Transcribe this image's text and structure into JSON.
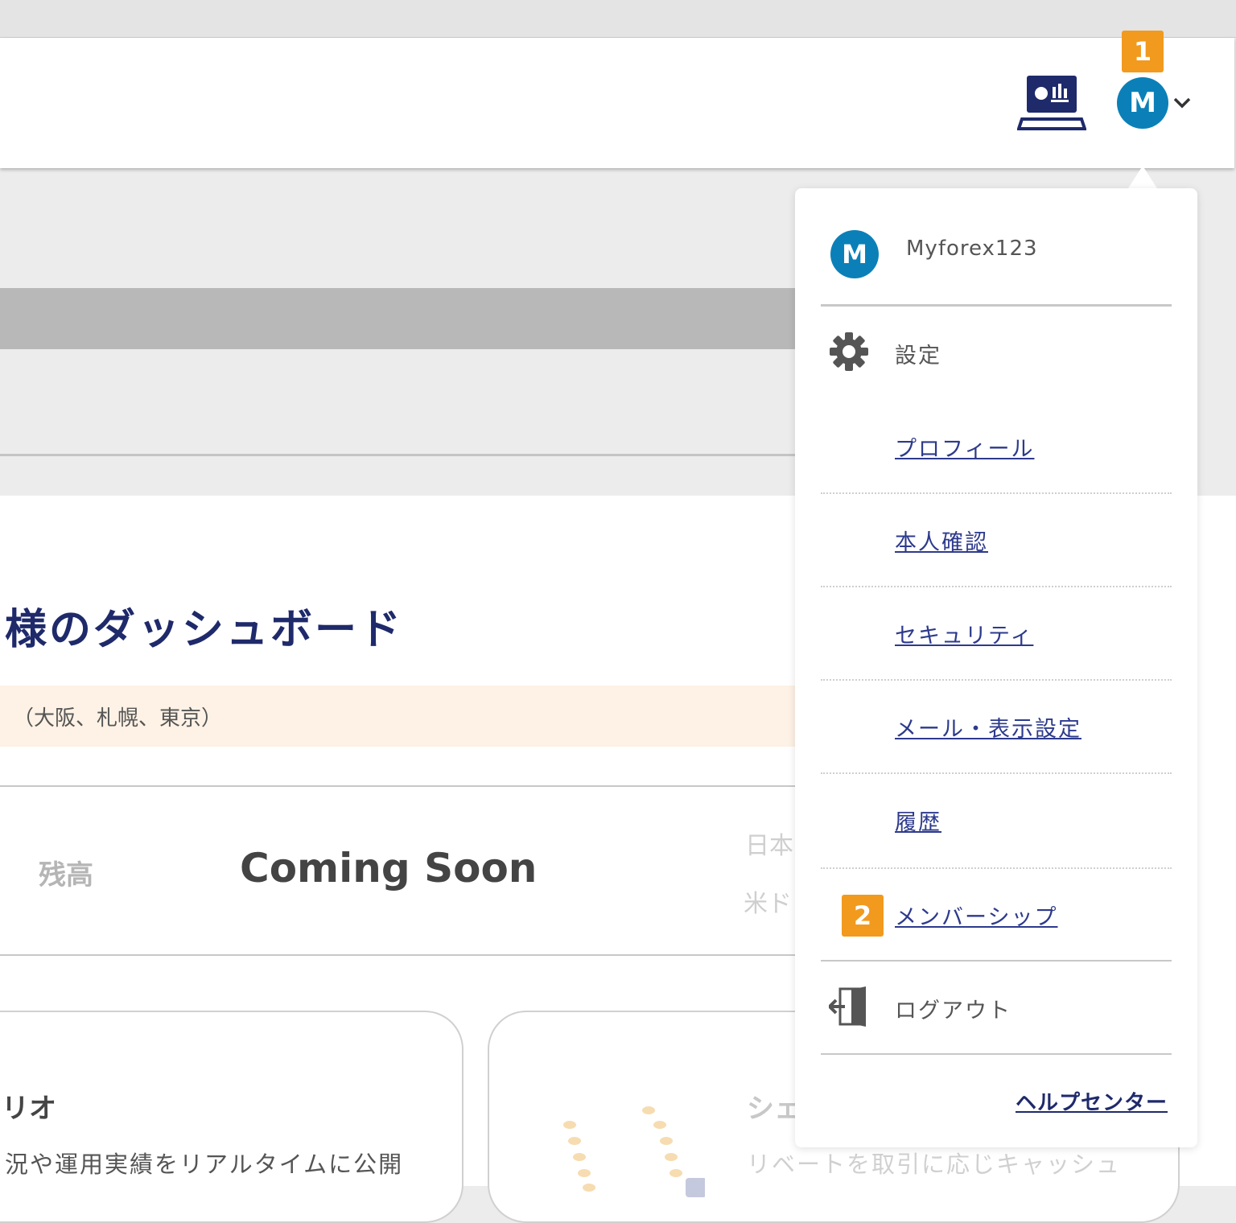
{
  "header": {
    "notification_count": "1",
    "avatar_initial": "M"
  },
  "dashboard": {
    "title": "様のダッシュボード",
    "notice": "（大阪、札幌、東京）",
    "balance_label": "残高",
    "balance_value": "Coming Soon",
    "currency_jpy_partial": "日本",
    "currency_usd_partial": "米ド"
  },
  "cards": [
    {
      "title": "リオ",
      "text": "況や運用実績をリアルタイムに公開"
    },
    {
      "title": "シェ",
      "text": "リベートを取引に応じキャッシュ"
    }
  ],
  "dropdown": {
    "avatar_initial": "M",
    "username": "Myforex123",
    "settings_label": "設定",
    "items": [
      {
        "label": "プロフィール"
      },
      {
        "label": "本人確認"
      },
      {
        "label": "セキュリティ"
      },
      {
        "label": "メール・表示設定"
      },
      {
        "label": "履歴"
      },
      {
        "label": "メンバーシップ",
        "badge": "2"
      }
    ],
    "logout_label": "ログアウト",
    "help_label": "ヘルプセンター"
  },
  "colors": {
    "brand_navy": "#1f2a6b",
    "avatar_blue": "#0b80b8",
    "badge_orange": "#f19a1e"
  }
}
